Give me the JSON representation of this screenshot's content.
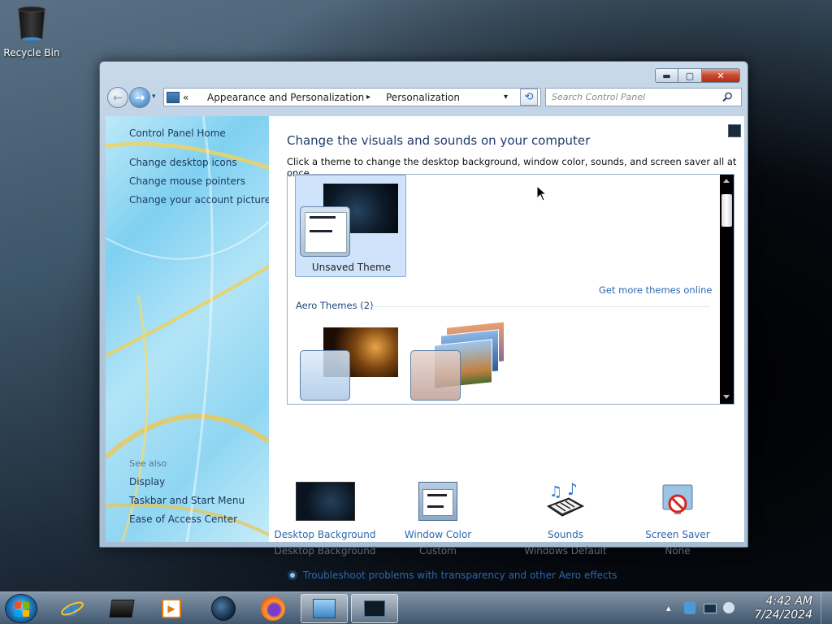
{
  "desktop": {
    "recycle_bin_label": "Recycle Bin"
  },
  "window": {
    "controls": {
      "minimize": "▬",
      "maximize": "▢",
      "close": "✕"
    },
    "address": {
      "prefix": "«",
      "crumbs": [
        "Appearance and Personalization",
        "Personalization"
      ],
      "separator": "▸",
      "dropdown": "▾"
    },
    "search_placeholder": "Search Control Panel",
    "refresh_glyph": "⟲",
    "nav": {
      "back": "←",
      "forward": "→",
      "history": "▾"
    }
  },
  "left_pane": {
    "home": "Control Panel Home",
    "links": [
      "Change desktop icons",
      "Change mouse pointers",
      "Change your account picture"
    ],
    "see_also_label": "See also",
    "see_also": [
      "Display",
      "Taskbar and Start Menu",
      "Ease of Access Center"
    ]
  },
  "main": {
    "title": "Change the visuals and sounds on your computer",
    "description": "Click a theme to change the desktop background, window color, sounds, and screen saver all at once.",
    "themes": {
      "unsaved": "Unsaved Theme",
      "get_more": "Get more themes online",
      "aero_group": "Aero Themes (2)"
    },
    "items": [
      {
        "label": "Desktop Background",
        "value": "Desktop Background",
        "icon": "desktop-background-icon"
      },
      {
        "label": "Window Color",
        "value": "Custom",
        "icon": "window-color-icon"
      },
      {
        "label": "Sounds",
        "value": "Windows Default",
        "icon": "sounds-icon"
      },
      {
        "label": "Screen Saver",
        "value": "None",
        "icon": "screen-saver-icon"
      }
    ],
    "troubleshoot": "Troubleshoot problems with transparency and other Aero effects"
  },
  "taskbar": {
    "time": "4:42 AM",
    "date": "7/24/2024",
    "tray_arrow": "▴",
    "pinned": [
      "internet-explorer-icon",
      "terminal-app-icon",
      "media-player-icon",
      "globe-app-icon",
      "firefox-icon",
      "personalization-icon",
      "screen-app-icon"
    ]
  },
  "colors": {
    "link": "#2c67b0",
    "title": "#1e3d6c",
    "selection": "#cfe4fa"
  }
}
